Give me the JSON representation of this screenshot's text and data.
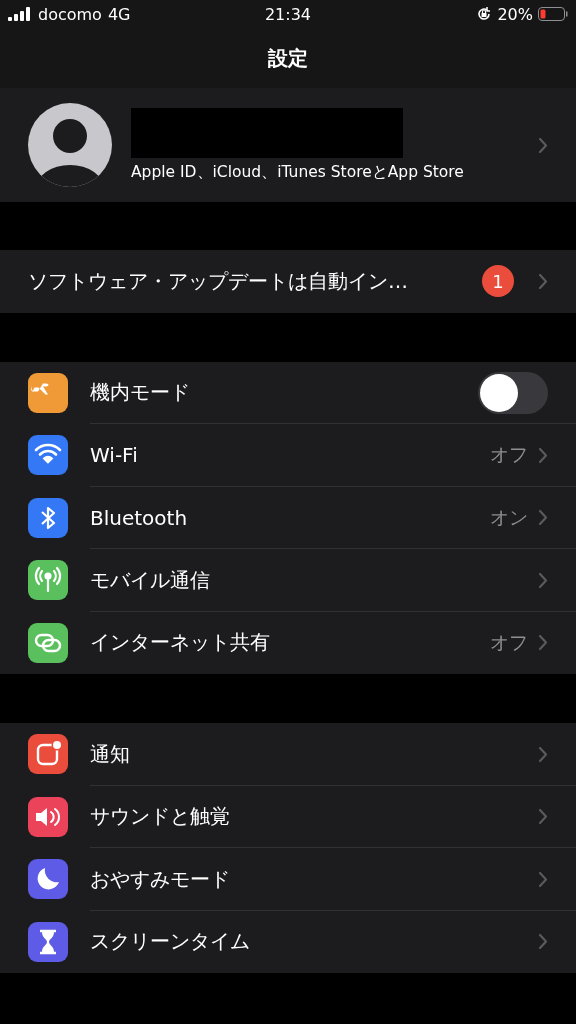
{
  "status_bar": {
    "carrier": "docomo",
    "network": "4G",
    "time": "21:34",
    "battery": "20%"
  },
  "nav": {
    "title": "設定"
  },
  "profile": {
    "subtitle": "Apple ID、iCloud、iTunes StoreとApp Store"
  },
  "update": {
    "label": "ソフトウェア・アップデートは自動イン…",
    "badge": "1"
  },
  "groups": [
    {
      "rows": [
        {
          "label": "機内モード",
          "color": "#f09a37",
          "kind": "toggle",
          "on": false
        },
        {
          "label": "Wi-Fi",
          "color": "#3478f6",
          "kind": "value",
          "value": "オフ"
        },
        {
          "label": "Bluetooth",
          "color": "#3478f6",
          "kind": "value",
          "value": "オン"
        },
        {
          "label": "モバイル通信",
          "color": "#5ac05e",
          "kind": "chevron"
        },
        {
          "label": "インターネット共有",
          "color": "#5ac05e",
          "kind": "value",
          "value": "オフ"
        }
      ]
    },
    {
      "rows": [
        {
          "label": "通知",
          "color": "#eb4d3d",
          "kind": "chevron"
        },
        {
          "label": "サウンドと触覚",
          "color": "#eb445a",
          "kind": "chevron"
        },
        {
          "label": "おやすみモード",
          "color": "#5e5ce6",
          "kind": "chevron"
        },
        {
          "label": "スクリーンタイム",
          "color": "#5e5ce6",
          "kind": "chevron"
        }
      ]
    }
  ]
}
